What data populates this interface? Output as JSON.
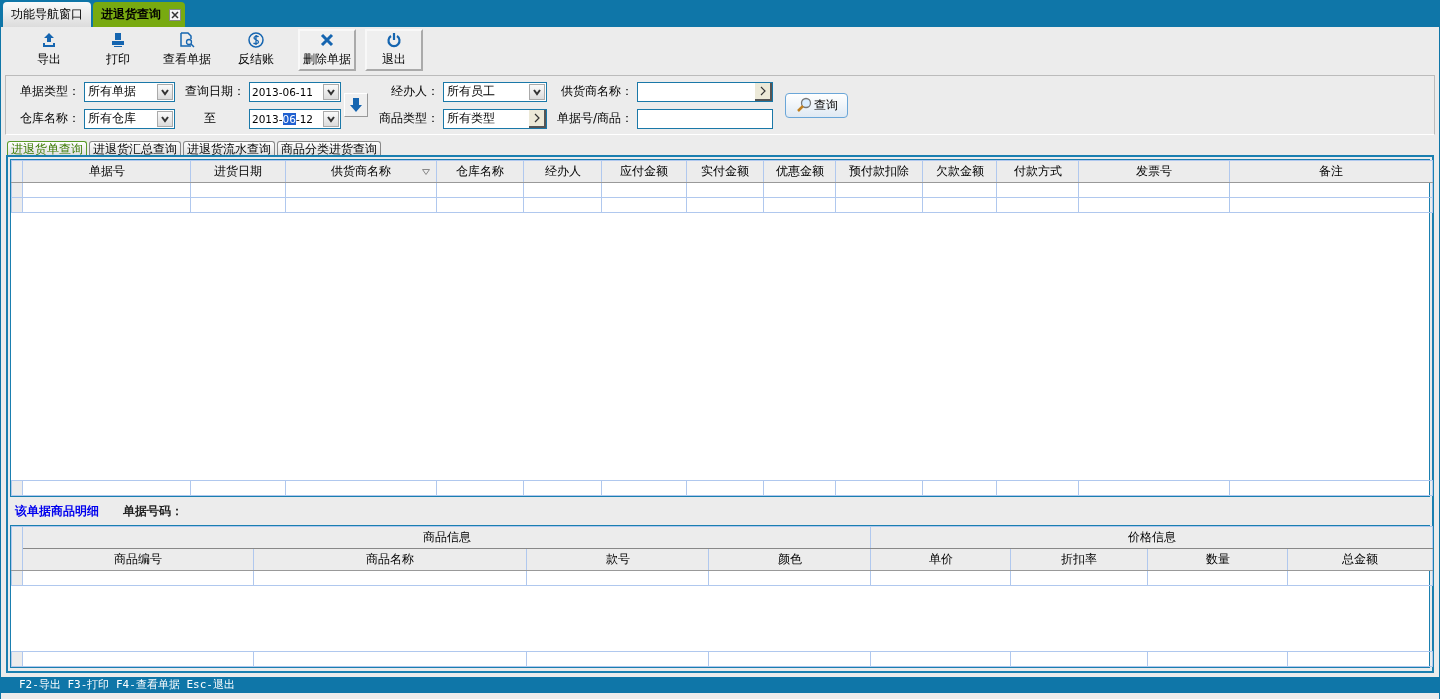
{
  "window_tabs": [
    {
      "label": "功能导航窗口",
      "selected": false,
      "closable": false
    },
    {
      "label": "进退货查询",
      "selected": true,
      "closable": true
    }
  ],
  "toolbar": [
    {
      "kind": "export",
      "label": "导出",
      "bordered": false
    },
    {
      "kind": "print",
      "label": "打印",
      "bordered": false
    },
    {
      "kind": "view",
      "label": "查看单据",
      "bordered": false
    },
    {
      "kind": "dollar",
      "label": "反结账",
      "bordered": false
    },
    {
      "kind": "delete",
      "label": "删除单据",
      "bordered": true
    },
    {
      "kind": "power",
      "label": "退出",
      "bordered": true
    }
  ],
  "filters": {
    "doc_type": {
      "label": "单据类型：",
      "value": "所有单据"
    },
    "warehouse": {
      "label": "仓库名称：",
      "value": "所有仓库"
    },
    "date_from": {
      "label": "查询日期：",
      "value": "2013-06-11"
    },
    "date_to": {
      "label": "至",
      "value_before": "2013-",
      "value_selected": "06",
      "value_after": "-12"
    },
    "handler": {
      "label": "经办人：",
      "value": "所有员工"
    },
    "product_type": {
      "label": "商品类型：",
      "value": "所有类型"
    },
    "supplier": {
      "label": "供货商名称："
    },
    "doc_no": {
      "label": "单据号/商品："
    },
    "search_button": "查询"
  },
  "sub_tabs": [
    {
      "label": "进退货单查询",
      "selected": true
    },
    {
      "label": "进退货汇总查询",
      "selected": false
    },
    {
      "label": "进退货流水查询",
      "selected": false
    },
    {
      "label": "商品分类进货查询",
      "selected": false
    }
  ],
  "table": {
    "columns": [
      {
        "label": "单据号",
        "sort_indicator": false
      },
      {
        "label": "进货日期",
        "sort_indicator": false
      },
      {
        "label": "供货商名称",
        "sort_indicator": true
      },
      {
        "label": "仓库名称",
        "sort_indicator": false
      },
      {
        "label": "经办人",
        "sort_indicator": false
      },
      {
        "label": "应付金额",
        "sort_indicator": false
      },
      {
        "label": "实付金额",
        "sort_indicator": false
      },
      {
        "label": "优惠金额",
        "sort_indicator": false
      },
      {
        "label": "预付款扣除",
        "sort_indicator": false
      },
      {
        "label": "欠款金额",
        "sort_indicator": false
      },
      {
        "label": "付款方式",
        "sort_indicator": false
      },
      {
        "label": "发票号",
        "sort_indicator": false
      },
      {
        "label": "备注",
        "sort_indicator": false
      }
    ]
  },
  "detail": {
    "title": "该单据商品明细",
    "doc_number_label": "单据号码：",
    "groups": [
      {
        "label": "商品信息",
        "columns": [
          "商品编号",
          "商品名称",
          "款号",
          "颜色"
        ]
      },
      {
        "label": "价格信息",
        "columns": [
          "单价",
          "折扣率",
          "数量",
          "总金额"
        ]
      }
    ]
  },
  "status_bar": "F2-导出 F3-打印 F4-查看单据 Esc-退出"
}
